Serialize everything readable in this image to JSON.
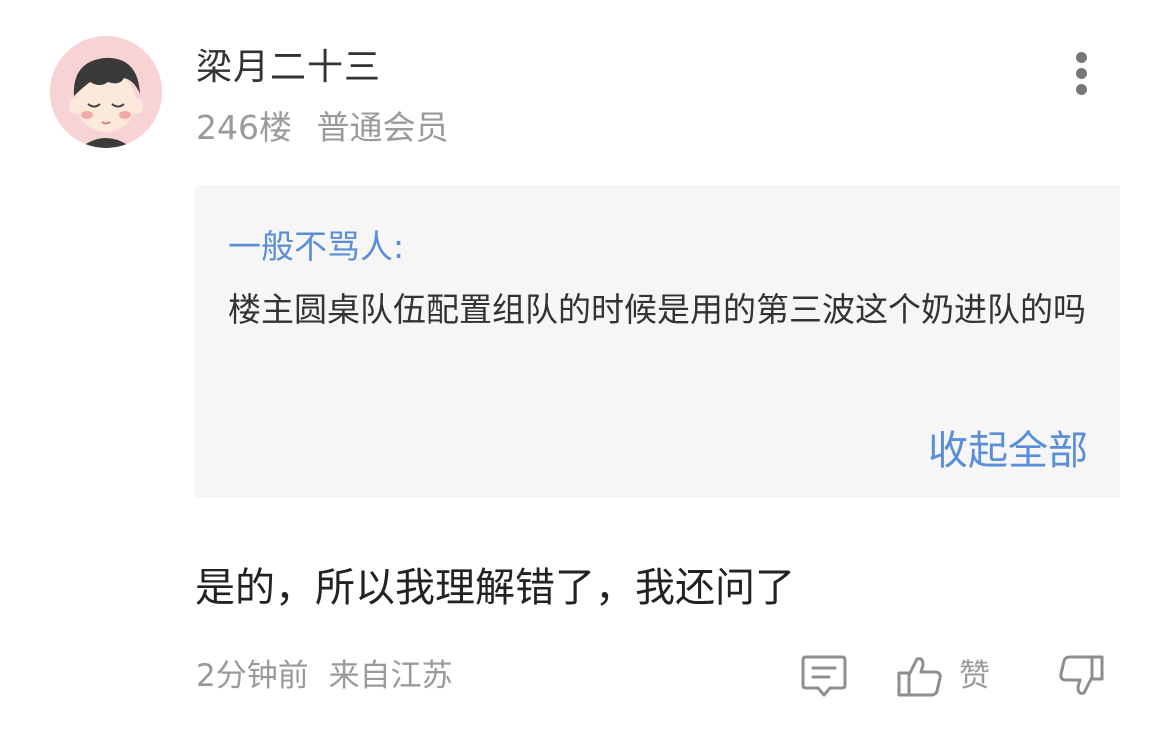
{
  "post": {
    "username": "梁月二十三",
    "floor": "246楼",
    "member_level": "普通会员"
  },
  "quote": {
    "author": "一般不骂人:",
    "text": "楼主圆桌队伍配置组队的时候是用的第三波这个奶进队的吗",
    "collapse_label": "收起全部"
  },
  "reply": {
    "text": "是的，所以我理解错了，我还问了"
  },
  "footer": {
    "time": "2分钟前",
    "location": "来自江苏",
    "like_label": "赞"
  },
  "icons": {
    "more": "more-vertical-icon",
    "comment": "comment-icon",
    "like": "thumbs-up-icon",
    "dislike": "thumbs-down-icon"
  },
  "colors": {
    "accent_blue": "#5a8ed8",
    "avatar_bg": "#f8d3d6",
    "quote_bg": "#f6f6f6",
    "muted_text": "#9a9a9a"
  }
}
